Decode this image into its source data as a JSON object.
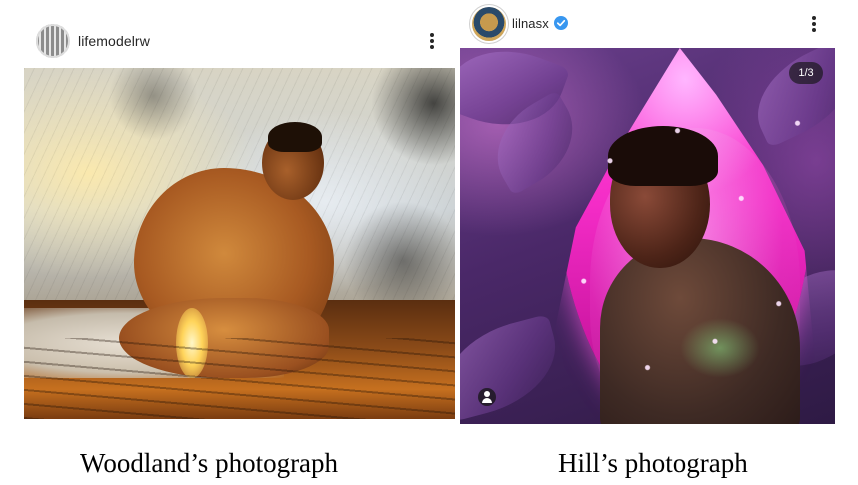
{
  "posts": [
    {
      "username": "lifemodelrw",
      "avatar": "avatar-pattern",
      "menu_icon": "more-vertical-icon",
      "caption": "Woodland’s photograph"
    },
    {
      "username": "lilnasx",
      "avatar": "avatar-photo",
      "verified": true,
      "verified_color": "#3897f0",
      "menu_icon": "more-vertical-icon",
      "carousel_counter": "1/3",
      "user_tag_icon": "user-tag-icon",
      "caption": "Hill’s photograph"
    }
  ],
  "colors": {
    "text": "#262626",
    "background": "#ffffff",
    "accent_pink": "#f42cc7"
  }
}
